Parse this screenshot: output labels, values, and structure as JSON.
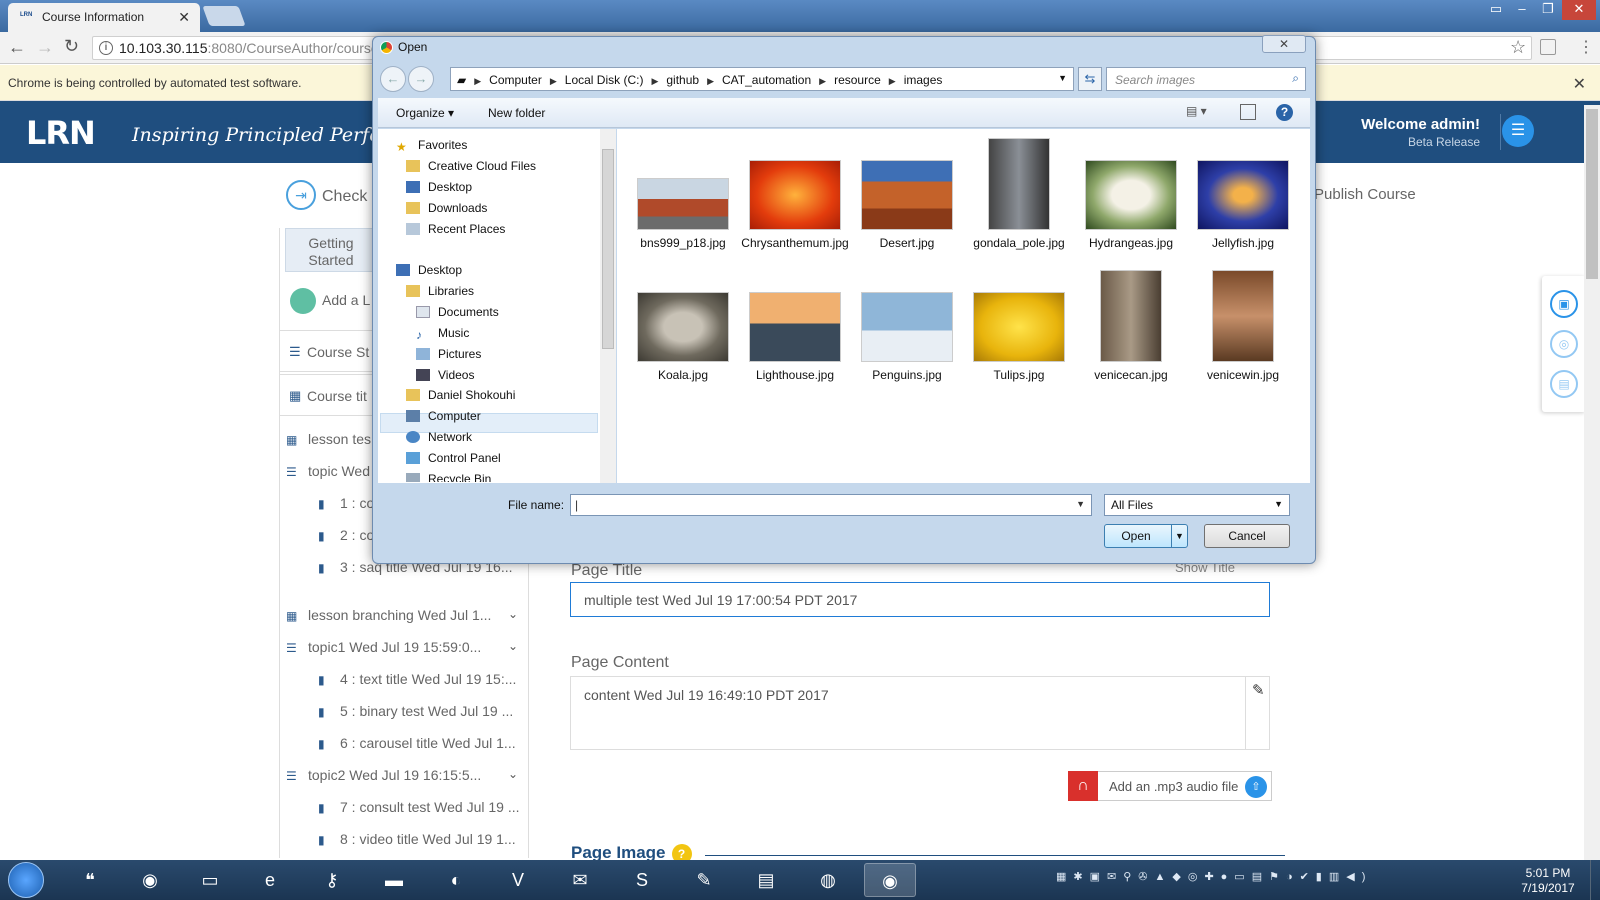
{
  "browser": {
    "tab_title": "Course Information",
    "favicon_text": "LRN",
    "url_host": "10.103.30.115",
    "url_rest": ":8080/CourseAuthor/course",
    "infobar_text": "Chrome is being controlled by automated test software."
  },
  "app": {
    "logo": "LRN",
    "tagline": "Inspiring Principled Performa",
    "welcome": "Welcome admin!",
    "release": "Beta Release",
    "check_label": "Check",
    "publish_label": "Publish Course"
  },
  "sidebar": {
    "getting_started": "Getting Started",
    "add_lesson": "Add a L",
    "course_structure": "Course St",
    "course_title": "Course tit",
    "rows": [
      {
        "kind": "lesson",
        "label": "lesson tes"
      },
      {
        "kind": "topic",
        "label": "topic Wed"
      },
      {
        "kind": "page",
        "label": "1 : co"
      },
      {
        "kind": "page",
        "label": "2 : co"
      },
      {
        "kind": "page",
        "label": "3 : saq title Wed Jul 19 16..."
      },
      {
        "kind": "lesson",
        "label": "lesson branching Wed Jul 1..."
      },
      {
        "kind": "topic",
        "label": "topic1 Wed Jul 19 15:59:0..."
      },
      {
        "kind": "page",
        "label": "4 : text title Wed Jul 19 15:..."
      },
      {
        "kind": "page",
        "label": "5 : binary test Wed Jul 19 ..."
      },
      {
        "kind": "page",
        "label": "6 : carousel title Wed Jul 1..."
      },
      {
        "kind": "topic",
        "label": "topic2 Wed Jul 19 16:15:5..."
      },
      {
        "kind": "page",
        "label": "7 : consult test Wed Jul 19 ..."
      },
      {
        "kind": "page",
        "label": "8 : video title Wed Jul 19 1..."
      }
    ]
  },
  "editor": {
    "page_title_label": "Page Title",
    "show_title": "Show Title",
    "page_title_value": "multiple test Wed Jul 19 17:00:54 PDT 2017",
    "page_content_label": "Page Content",
    "page_content_value": "content Wed Jul 19 16:49:10 PDT 2017",
    "audio_label": "Add an .mp3 audio file",
    "page_image_label": "Page Image"
  },
  "dialog": {
    "title": "Open",
    "close": "✕",
    "path": [
      "Computer",
      "Local Disk (C:)",
      "github",
      "CAT_automation",
      "resource",
      "images"
    ],
    "search_placeholder": "Search images",
    "organize": "Organize ▾",
    "new_folder": "New folder",
    "nav": [
      "Favorites",
      "Creative Cloud Files",
      "Desktop",
      "Downloads",
      "Recent Places",
      "Desktop",
      "Libraries",
      "Documents",
      "Music",
      "Pictures",
      "Videos",
      "Daniel Shokouhi",
      "Computer",
      "Network",
      "Control Panel",
      "Recycle Bin"
    ],
    "files": [
      "bns999_p18.jpg",
      "Chrysanthemum.jpg",
      "Desert.jpg",
      "gondala_pole.jpg",
      "Hydrangeas.jpg",
      "Jellyfish.jpg",
      "Koala.jpg",
      "Lighthouse.jpg",
      "Penguins.jpg",
      "Tulips.jpg",
      "venicecan.jpg",
      "venicewin.jpg"
    ],
    "file_name_label": "File name:",
    "file_name_value": "",
    "file_type": "All Files",
    "open": "Open",
    "cancel": "Cancel"
  },
  "taskbar": {
    "time": "5:01 PM",
    "date": "7/19/2017"
  },
  "colors": {
    "header": "#1f4e7f",
    "accent": "#2a93e8",
    "audio_red": "#d9302c"
  }
}
